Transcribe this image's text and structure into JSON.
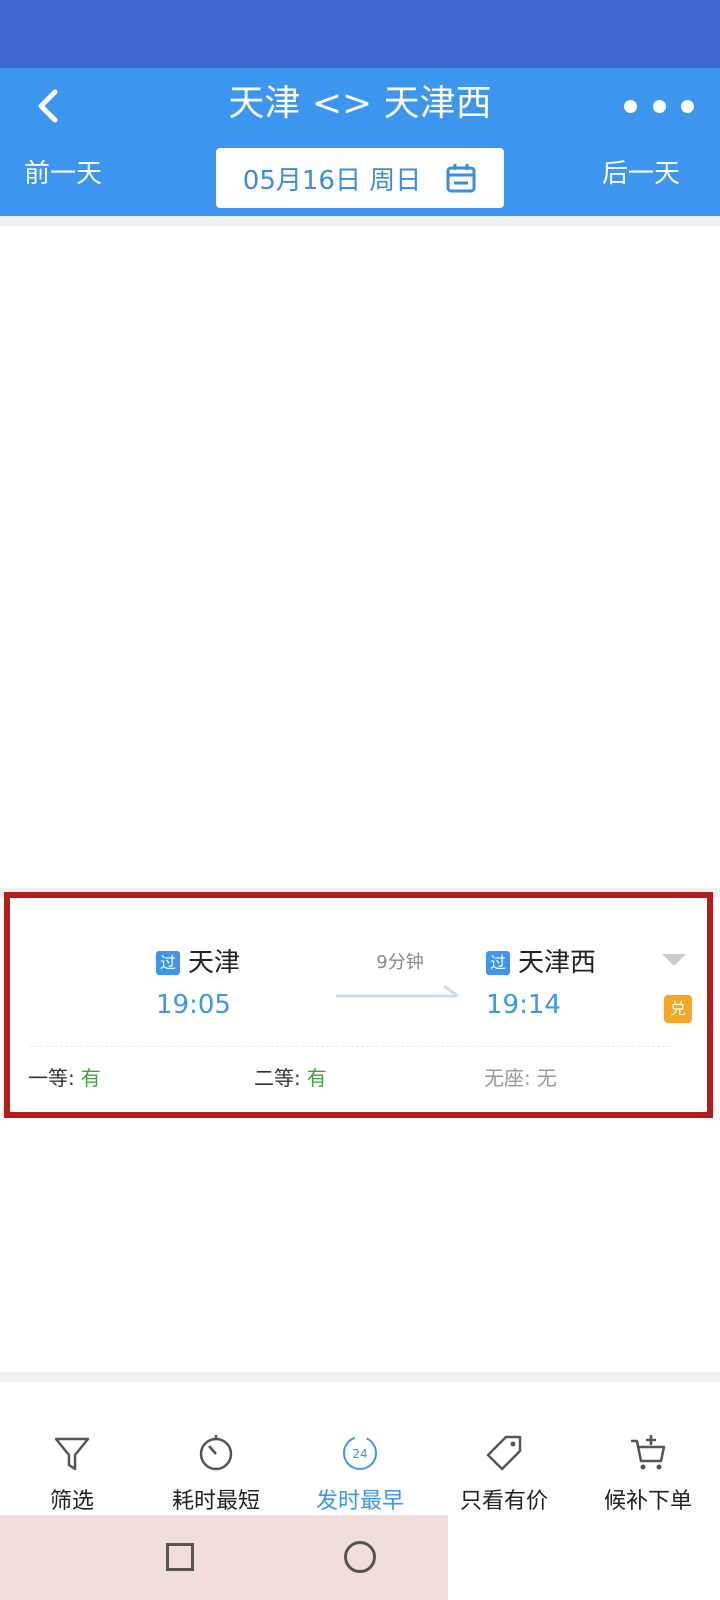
{
  "header": {
    "title": "天津 <> 天津西",
    "prev_day_label": "前一天",
    "next_day_label": "后一天",
    "date_label": "05月16日 周日"
  },
  "train": {
    "from_tag": "过",
    "from_station": "天津",
    "from_time": "19:05",
    "to_tag": "过",
    "to_station": "天津西",
    "to_time": "19:14",
    "duration": "9分钟",
    "exchange_badge": "兑",
    "seats": [
      {
        "label": "一等:",
        "value": "有"
      },
      {
        "label": "二等:",
        "value": "有"
      },
      {
        "label": "无座:",
        "value": "无"
      }
    ]
  },
  "bottom_tabs": [
    {
      "label": "筛选",
      "icon": "filter-icon"
    },
    {
      "label": "耗时最短",
      "icon": "stopwatch-icon"
    },
    {
      "label": "发时最早",
      "icon": "clock-24-icon",
      "icon_text": "24"
    },
    {
      "label": "只看有价",
      "icon": "price-tag-icon"
    },
    {
      "label": "候补下单",
      "icon": "cart-plus-icon"
    }
  ],
  "colors": {
    "status_bar": "#4169d6",
    "nav_bar": "#3c95ee",
    "accent": "#3c95ee",
    "available": "#3fa243",
    "highlight": "#b51c1c",
    "exchange": "#f5a623"
  }
}
